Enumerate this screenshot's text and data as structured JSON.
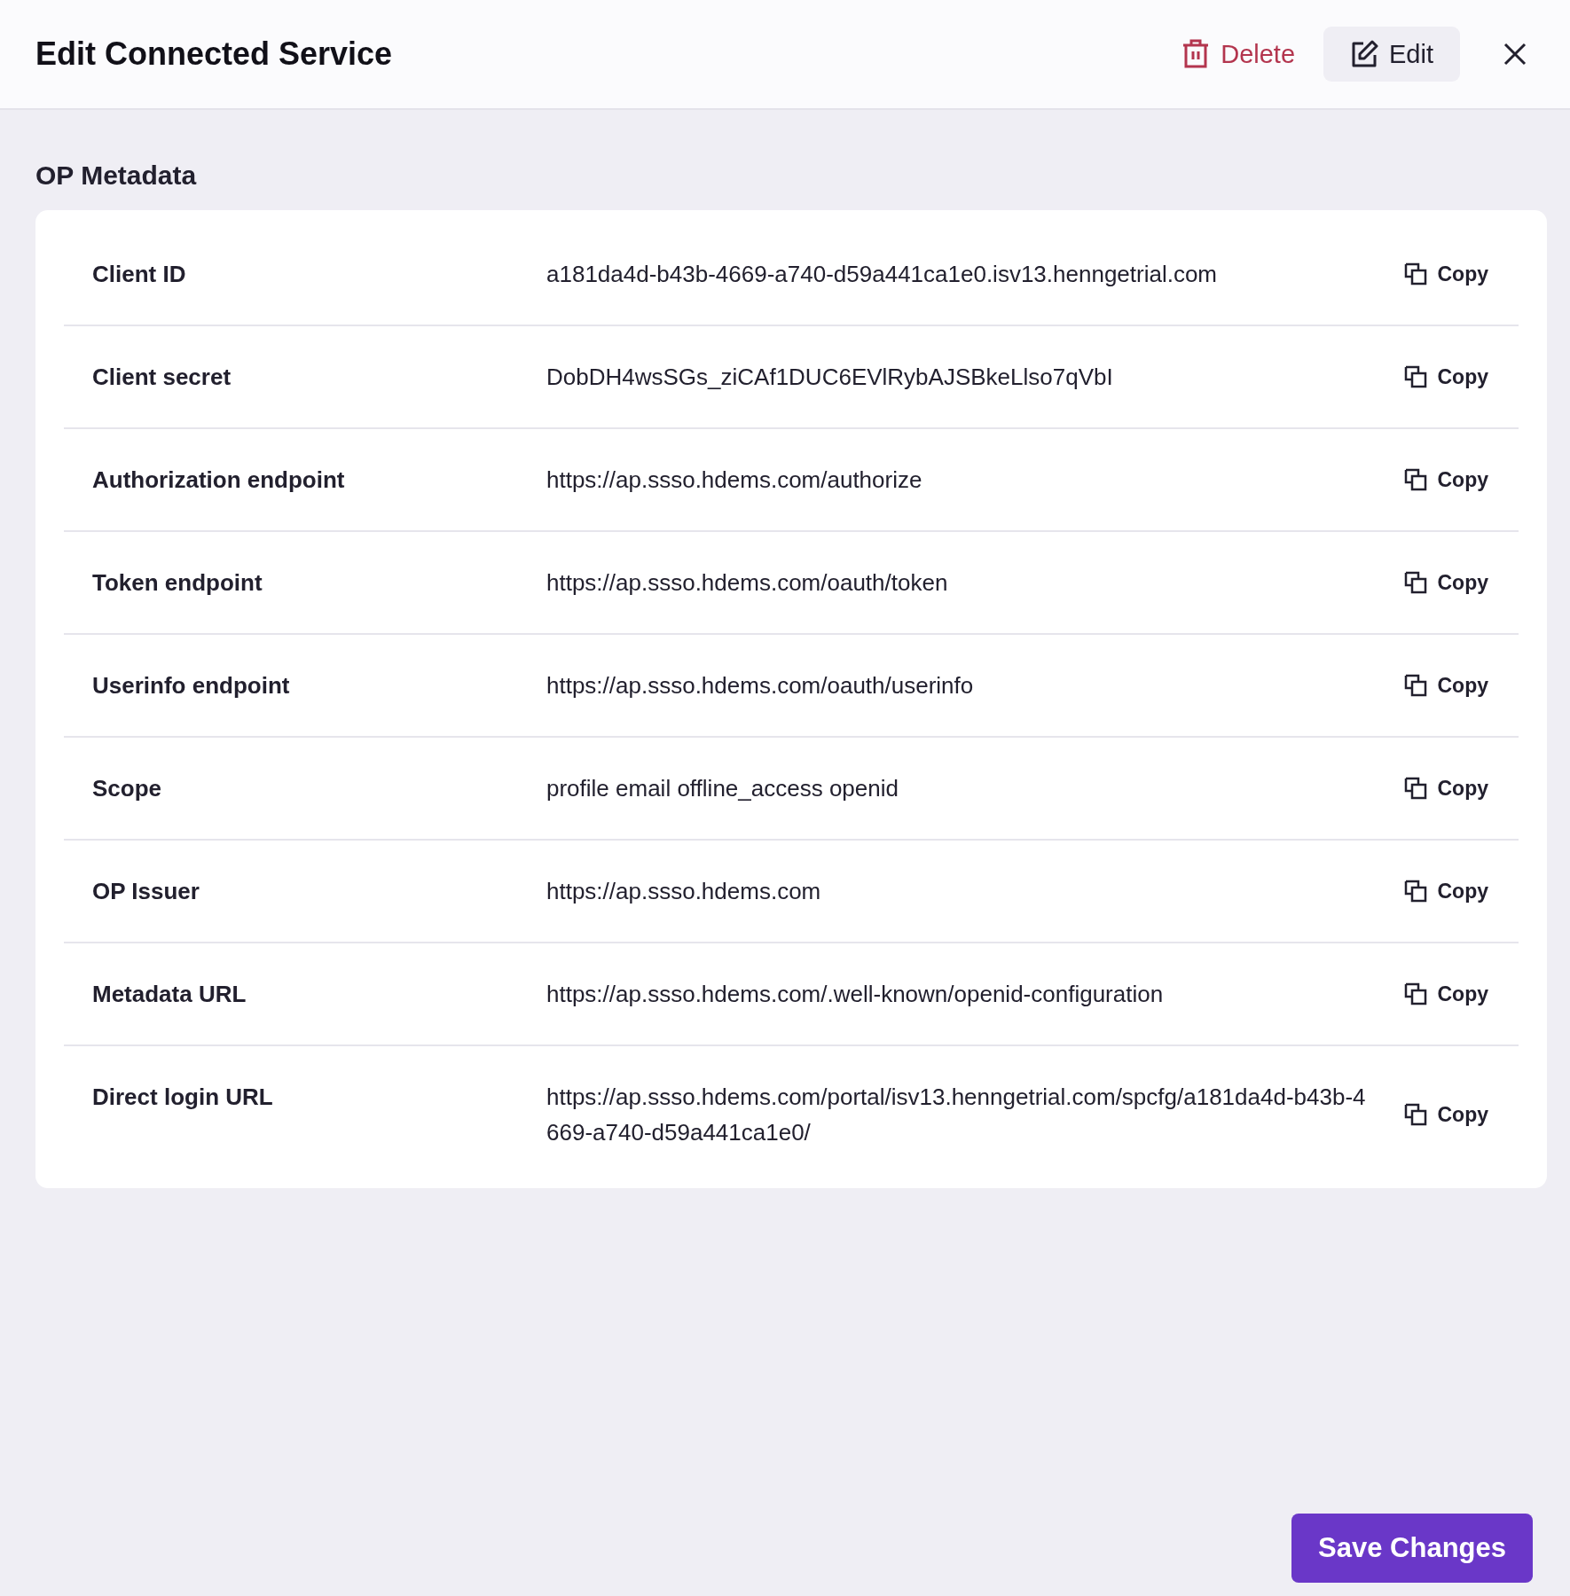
{
  "header": {
    "title": "Edit Connected Service",
    "actions": [
      {
        "kind": "delete",
        "label": "Delete"
      },
      {
        "kind": "edit",
        "label": "Edit"
      }
    ]
  },
  "section": {
    "title": "OP Metadata",
    "rows": [
      {
        "label": "Client ID",
        "value": "a181da4d-b43b-4669-a740-d59a441ca1e0.isv13.henngetrial.com",
        "action": "Copy"
      },
      {
        "label": "Client secret",
        "value": "DobDH4wsSGs_ziCAf1DUC6EVlRybAJSBkeLlso7qVbI",
        "action": "Copy"
      },
      {
        "label": "Authorization endpoint",
        "value": "https://ap.ssso.hdems.com/authorize",
        "action": "Copy"
      },
      {
        "label": "Token endpoint",
        "value": "https://ap.ssso.hdems.com/oauth/token",
        "action": "Copy"
      },
      {
        "label": "Userinfo endpoint",
        "value": "https://ap.ssso.hdems.com/oauth/userinfo",
        "action": "Copy"
      },
      {
        "label": "Scope",
        "value": "profile email offline_access openid",
        "action": "Copy"
      },
      {
        "label": "OP Issuer",
        "value": "https://ap.ssso.hdems.com",
        "action": "Copy"
      },
      {
        "label": "Metadata URL",
        "value": "https://ap.ssso.hdems.com/.well-known/openid-configuration",
        "action": "Copy"
      },
      {
        "label": "Direct login URL",
        "value": "https://ap.ssso.hdems.com/portal/isv13.henngetrial.com/spcfg/a181da4d-b43b-4669-a740-d59a441ca1e0/",
        "action": "Copy"
      }
    ]
  },
  "footer": {
    "save_button": "Save Changes"
  }
}
